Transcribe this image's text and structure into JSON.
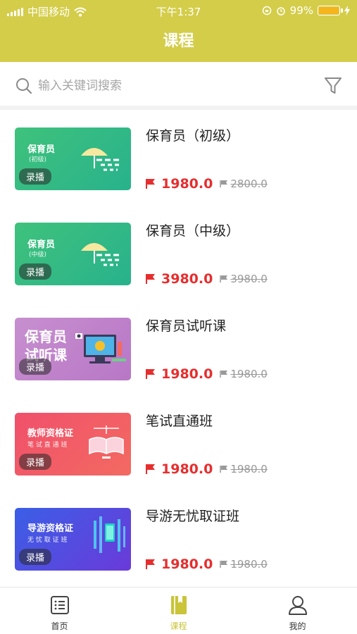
{
  "status_bar": {
    "carrier": "中国移动",
    "time": "下午1:37",
    "battery": "99%",
    "battery_level": 0.99
  },
  "header": {
    "title": "课程"
  },
  "search": {
    "placeholder": "输入关键词搜索"
  },
  "courses": [
    {
      "name": "保育员（初级）",
      "price": "1980.0",
      "old_price": "2800.0",
      "badge": "录播",
      "thumb_title": "保育员",
      "thumb_sub": "(初级)",
      "thumb_colors": [
        "#3fc27c",
        "#28b28c"
      ]
    },
    {
      "name": "保育员（中级）",
      "price": "3980.0",
      "old_price": "3980.0",
      "badge": "录播",
      "thumb_title": "保育员",
      "thumb_sub": "(中级)",
      "thumb_colors": [
        "#3fc27c",
        "#28b28c"
      ]
    },
    {
      "name": "保育员试听课",
      "price": "1980.0",
      "old_price": "1980.0",
      "badge": "录播",
      "thumb_title": "保育员 试听课",
      "thumb_sub": "",
      "thumb_colors": [
        "#c78fcf",
        "#b877c6"
      ]
    },
    {
      "name": "笔试直通班",
      "price": "1980.0",
      "old_price": "1980.0",
      "badge": "录播",
      "thumb_title": "教师资格证",
      "thumb_sub": "笔 试 直 通 班",
      "thumb_colors": [
        "#f0506b",
        "#f36a61"
      ]
    },
    {
      "name": "导游无忧取证班",
      "price": "1980.0",
      "old_price": "1980.0",
      "badge": "录播",
      "thumb_title": "导游资格证",
      "thumb_sub": "无 忧 取 证 班",
      "thumb_colors": [
        "#3a5fe6",
        "#6b3ad9"
      ]
    }
  ],
  "tabs": [
    {
      "label": "首页",
      "icon": "list-icon",
      "active": false
    },
    {
      "label": "课程",
      "icon": "book-icon",
      "active": true
    },
    {
      "label": "我的",
      "icon": "user-icon",
      "active": false
    }
  ],
  "colors": {
    "accent": "#d4cd4a",
    "price": "#e62e2e"
  }
}
